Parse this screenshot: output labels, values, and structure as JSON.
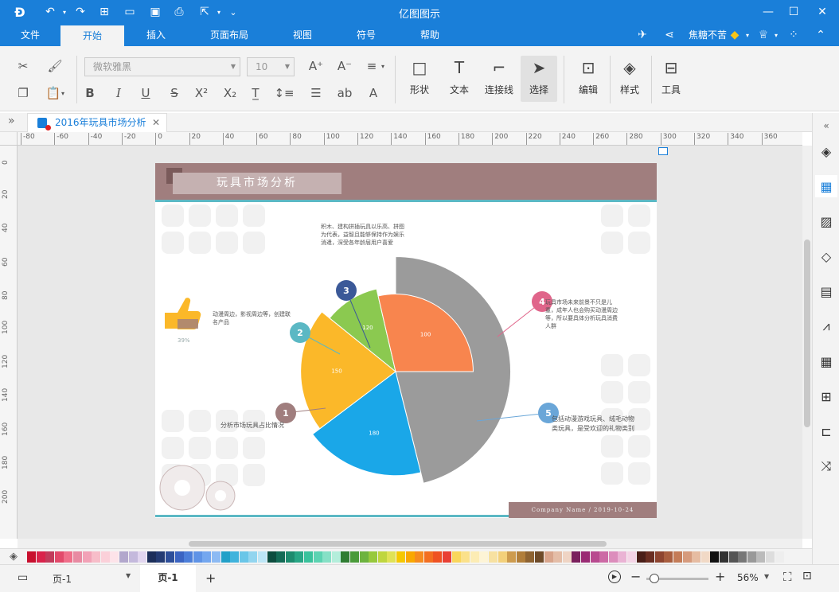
{
  "app": {
    "title": "亿图图示"
  },
  "menu": {
    "items": [
      "文件",
      "开始",
      "插入",
      "页面布局",
      "视图",
      "符号",
      "帮助"
    ],
    "active": "开始"
  },
  "user": {
    "name": "焦糖不苦"
  },
  "ribbon": {
    "font_name": "微软雅黑",
    "font_size": "10",
    "big_buttons": [
      {
        "label": "形状"
      },
      {
        "label": "文本"
      },
      {
        "label": "连接线"
      },
      {
        "label": "选择"
      },
      {
        "label": "编辑"
      },
      {
        "label": "样式"
      },
      {
        "label": "工具"
      }
    ]
  },
  "document": {
    "tab_title": "2016年玩具市场分析"
  },
  "rulers": {
    "h_ticks": [
      "-80",
      "-60",
      "-40",
      "-20",
      "0",
      "20",
      "40",
      "60",
      "80",
      "100",
      "120",
      "140",
      "160",
      "180",
      "200",
      "220",
      "240",
      "260",
      "280",
      "300",
      "320",
      "340",
      "360"
    ],
    "v_ticks": [
      "0",
      "20",
      "40",
      "60",
      "80",
      "100",
      "120",
      "140",
      "160",
      "180",
      "200"
    ]
  },
  "diagram": {
    "title": "玩具市场分析",
    "footer": "Company Name / 2019-10-24",
    "caption": "分析市场玩具占比情况",
    "thumb_percent": "39%",
    "notes": [
      {
        "num": "1",
        "text": ""
      },
      {
        "num": "2",
        "text": "动漫周边，影视周边等，创建联名产品"
      },
      {
        "num": "3",
        "text": "积木、建构拼插玩具以乐高、拼图为代表，益智且能够保持作为娱乐消遣，深受各年龄层用户喜爱"
      },
      {
        "num": "4",
        "text": "玩具市场未来前景不只是儿童，成年人也会购买动漫周边等，所以要具体分析玩具消费人群"
      },
      {
        "num": "5",
        "text": "包括动漫游戏玩具、绒毛动物类玩具，是受欢迎的礼物类别"
      }
    ]
  },
  "chart_data": {
    "type": "pie",
    "variant": "rose",
    "title": "",
    "values": [
      220,
      180,
      150,
      120,
      100
    ],
    "colors": [
      "#9b9b9b",
      "#1aa7e8",
      "#fbb829",
      "#8bc950",
      "#f8854e"
    ]
  },
  "palette": [
    "#c8102e",
    "#d9234b",
    "#c23b5b",
    "#e24a6b",
    "#ef6f8a",
    "#e88aa2",
    "#f2a2b7",
    "#f7bdc9",
    "#fbd0d9",
    "#fde3e9",
    "#b2a7cc",
    "#c4b9dc",
    "#e1d5ef",
    "#1c2e5a",
    "#243b73",
    "#2d4e99",
    "#3b64c2",
    "#4c7ed9",
    "#5f93e6",
    "#74a7ef",
    "#8cbaf3",
    "#22a0c8",
    "#3fb3dc",
    "#6ac6e8",
    "#92d5ef",
    "#bde6f6",
    "#0d4d3f",
    "#146b56",
    "#1d8b6e",
    "#28a685",
    "#3ac29c",
    "#5cd3b2",
    "#86e0c6",
    "#b4eedb",
    "#2f7d32",
    "#4a9b3a",
    "#6db33f",
    "#97c93d",
    "#bfd63f",
    "#e0e256",
    "#f5c800",
    "#f9a800",
    "#f68b1f",
    "#f36f21",
    "#ef5223",
    "#e94034",
    "#f9d65c",
    "#fbe18a",
    "#fcec b4",
    "#fdf4d6",
    "#f7e1a1",
    "#f3d07a",
    "#cd9b4e",
    "#b17e3a",
    "#8e6331",
    "#6e4b29",
    "#d8a58c",
    "#e4bda7",
    "#efd4c4",
    "#7a1f5c",
    "#9a2b74",
    "#b84a8f",
    "#cc6aa5",
    "#dc8dbc",
    "#eab3d4",
    "#f4d4e6",
    "#4a1f18",
    "#6a2e22",
    "#8e4530",
    "#a95e3f",
    "#c47c58",
    "#d69b7d",
    "#e6bca2",
    "#f1d9c6",
    "#111111",
    "#333333",
    "#555555",
    "#777777",
    "#999999",
    "#bbbbbb",
    "#dddddd",
    "#eeeeee"
  ],
  "status": {
    "page_select": "页-1",
    "page_tab": "页-1",
    "zoom": "56%"
  }
}
